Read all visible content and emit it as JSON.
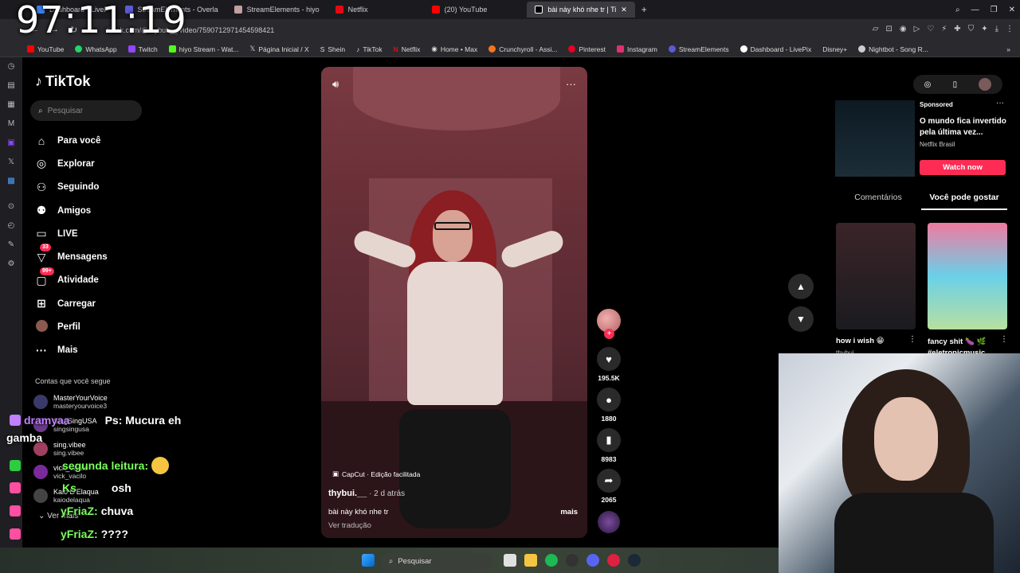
{
  "clock": "97:11:19",
  "browser": {
    "tabs": [
      {
        "label": "Dashboard - LiveP",
        "color": "#3b82f6"
      },
      {
        "label": "StreamElements - Overla",
        "color": "#5b5bd6"
      },
      {
        "label": "StreamElements - hiyo",
        "color": "#c0a0a0"
      },
      {
        "label": "Netflix",
        "color": "#e50914"
      },
      {
        "label": "(20) YouTube",
        "color": "#ff0000"
      },
      {
        "label": "bài này khó nhe tr | Ti",
        "color": "#000000",
        "active": true
      }
    ],
    "url": "tiktok.com/@thybui.__/video/7590712971454598421",
    "bookmarks": [
      {
        "label": "YouTube",
        "color": "#ff0000"
      },
      {
        "label": "WhatsApp",
        "color": "#25d366"
      },
      {
        "label": "Twitch",
        "color": "#9146ff"
      },
      {
        "label": "hiyo Stream - Wat...",
        "color": "#53fc18"
      },
      {
        "label": "Página Inicial / X",
        "color": "#ffffff"
      },
      {
        "label": "Shein",
        "color": "#ffffff"
      },
      {
        "label": "TikTok",
        "color": "#ffffff"
      },
      {
        "label": "Netflix",
        "color": "#e50914"
      },
      {
        "label": "Home • Max",
        "color": "#ffffff"
      },
      {
        "label": "Crunchyroll - Assi...",
        "color": "#f47521"
      },
      {
        "label": "Pinterest",
        "color": "#e60023"
      },
      {
        "label": "Instagram",
        "color": "#e1306c"
      },
      {
        "label": "StreamElements",
        "color": "#5b5bd6"
      },
      {
        "label": "Dashboard - LivePix",
        "color": "#ffffff"
      },
      {
        "label": "Disney+",
        "color": "#113ccf"
      },
      {
        "label": "Nightbot - Song R...",
        "color": "#cccccc"
      }
    ]
  },
  "tiktok": {
    "logo": "TikTok",
    "search_placeholder": "Pesquisar",
    "nav": [
      {
        "label": "Para você",
        "icon": "home-icon"
      },
      {
        "label": "Explorar",
        "icon": "compass-icon"
      },
      {
        "label": "Seguindo",
        "icon": "following-icon"
      },
      {
        "label": "Amigos",
        "icon": "friends-icon"
      },
      {
        "label": "LIVE",
        "icon": "live-icon"
      },
      {
        "label": "Mensagens",
        "icon": "message-icon",
        "badge": "33"
      },
      {
        "label": "Atividade",
        "icon": "activity-icon",
        "badge": "99+"
      },
      {
        "label": "Carregar",
        "icon": "upload-icon"
      },
      {
        "label": "Perfil",
        "icon": "profile-icon"
      },
      {
        "label": "Mais",
        "icon": "more-icon"
      }
    ],
    "following_title": "Contas que você segue",
    "following": [
      {
        "name": "MasterYourVoice",
        "handle": "masteryourvoice3"
      },
      {
        "name": "SingSingUSA",
        "handle": "singsingusa"
      },
      {
        "name": "sing.vibee",
        "handle": "sing.vibee"
      },
      {
        "name": "vick_vacilo",
        "handle": "vick_vacilo"
      },
      {
        "name": "Kaio D'Elaqua",
        "handle": "kaiodelaqua"
      }
    ],
    "ver_mais": "Ver mais",
    "video": {
      "capcut": "CapCut · Edição facilitada",
      "author": "thybui.__",
      "time": " · 2 d atrás",
      "description": "bài này khó nhe tr",
      "more": "mais",
      "translate": "Ver tradução"
    },
    "actions": {
      "likes": "195.5K",
      "comments": "1880",
      "saves": "8983",
      "shares": "2065"
    },
    "sponsored": {
      "label": "Sponsored",
      "title": "O mundo fica invertido pela última vez...",
      "sub": "Netflix Brasil",
      "cta": "Watch now"
    },
    "tabs": [
      "Comentários",
      "Você pode gostar"
    ],
    "cards": [
      {
        "title": "how i wish 😁",
        "author": "thybui"
      },
      {
        "title": "fancy shit 🍆 🌿 #eletronicmusic",
        "author": ""
      }
    ]
  },
  "chat": [
    {
      "user": "dramyaa",
      "message": "Ps: Mucura eh",
      "color": "#c080ff"
    },
    {
      "user": "",
      "message": "gamba",
      "color": "#ffffff"
    },
    {
      "user": "",
      "message": "segunda leitura:",
      "color": "#7bff5c"
    },
    {
      "user": "Ks",
      "message": "osh",
      "color": "#7bff5c"
    },
    {
      "user": "yFriaZ:",
      "message": "chuva",
      "color": "#7bff5c"
    },
    {
      "user": "yFriaZ:",
      "message": "????",
      "color": "#7bff5c"
    }
  ],
  "taskbar": {
    "search": "Pesquisar"
  }
}
